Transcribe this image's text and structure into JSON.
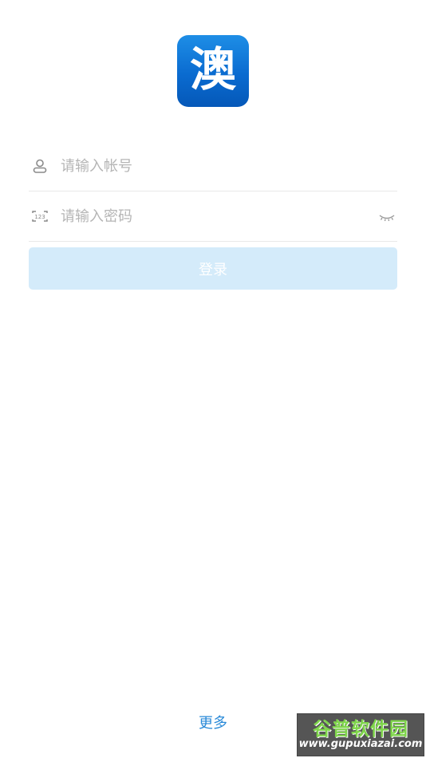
{
  "app": {
    "logo_char": "澳",
    "brand_color": "#0a6bd0"
  },
  "login_form": {
    "username_placeholder": "请输入帐号",
    "password_placeholder": "请输入密码",
    "username_icon": "user-icon",
    "password_icon": "keypad-123-icon",
    "password_toggle_icon": "eye-closed-icon",
    "submit_label": "登录",
    "submit_color": "#d4ebfa"
  },
  "footer": {
    "more_label": "更多",
    "more_color": "#2a8ad8"
  },
  "watermark": {
    "title": "谷普软件园",
    "url": "www.gupuxiazai.com"
  }
}
